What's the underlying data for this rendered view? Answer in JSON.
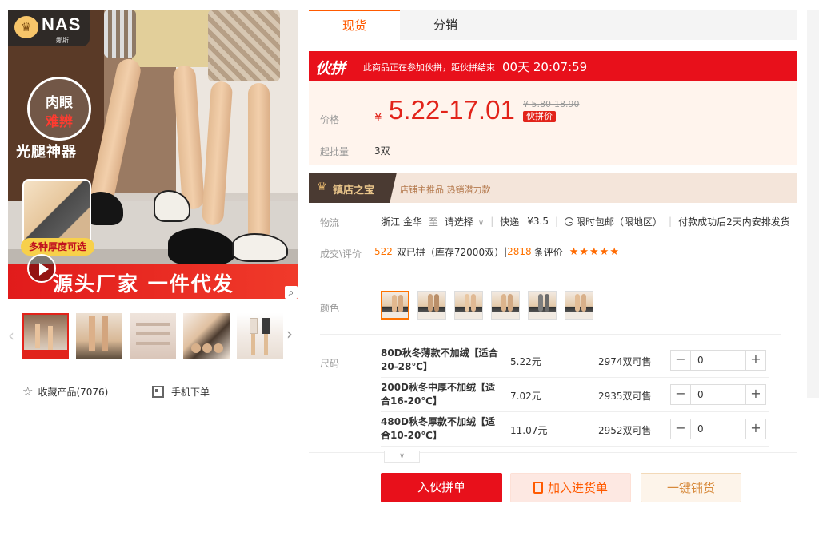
{
  "gallery": {
    "logo_text": "NAS",
    "logo_sub": "娜斯",
    "badge_line1": "肉眼",
    "badge_line2": "难辨",
    "slogan": "光腿神器",
    "thickness_label": "多种厚度可选",
    "banner_text": "源头厂家 一件代发",
    "zoom_icon": "search-icon"
  },
  "actions": {
    "favorite_label": "收藏产品(7076)",
    "mobile_order_label": "手机下单"
  },
  "tabs": [
    {
      "label": "现货",
      "active": true
    },
    {
      "label": "分销",
      "active": false
    }
  ],
  "promo": {
    "logo": "伙拼",
    "text": "此商品正在参加伙拼，距伙拼结束",
    "timer": "00天 20:07:59"
  },
  "price": {
    "label": "价格",
    "currency": "¥",
    "range": "5.22-17.01",
    "original": "¥ 5.80-18.90",
    "tag": "伙拼价",
    "moq_label": "起批量",
    "moq_value": "3双"
  },
  "shop": {
    "title": "镇店之宝",
    "tags": "店铺主推品  热销潜力款"
  },
  "shipping": {
    "label": "物流",
    "origin": "浙江 金华",
    "to": "至",
    "destination": "请选择",
    "carrier": "快递",
    "fee": "¥3.5",
    "free_ship": "限时包邮（限地区）",
    "dispatch": "付款成功后2天内安排发货"
  },
  "deals": {
    "label": "成交\\评价",
    "sold_count": "522",
    "sold_text": "双已拼（库存72000双）",
    "review_count": "2818",
    "review_text": "条评价",
    "rating": 4.5,
    "stars": "★★★★★"
  },
  "color": {
    "label": "颜色",
    "options": 6,
    "selected_index": 0
  },
  "sizes": {
    "label": "尺码",
    "rows": [
      {
        "name": "80D秋冬薄款不加绒【适合20-28℃】",
        "price": "5.22元",
        "stock": "2974双可售",
        "qty": "0"
      },
      {
        "name": "200D秋冬中厚不加绒【适合16-20℃】",
        "price": "7.02元",
        "stock": "2935双可售",
        "qty": "0"
      },
      {
        "name": "480D秋冬厚款不加绒【适合10-20℃】",
        "price": "11.07元",
        "stock": "2952双可售",
        "qty": "0"
      }
    ]
  },
  "buttons": {
    "group_buy": "入伙拼单",
    "add_cart": "加入进货单",
    "distribute": "一键铺货"
  },
  "colors": {
    "accent_red": "#e8101b",
    "accent_orange": "#ff5a00",
    "price_bg": "#fff4ed"
  }
}
